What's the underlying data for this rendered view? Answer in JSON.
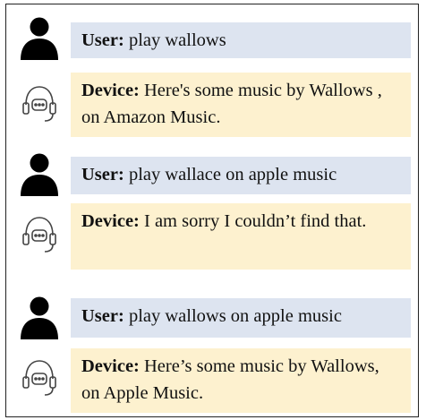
{
  "dialogue": [
    {
      "role": "user",
      "speaker": "User:",
      "text": "play wallows",
      "icon": "user-icon"
    },
    {
      "role": "device",
      "speaker": "Device:",
      "text": "Here's some music by Wallows , on Amazon Music.",
      "icon": "headset-assistant-icon"
    },
    {
      "role": "user",
      "speaker": "User:",
      "text": "play wallace on apple music",
      "icon": "user-icon"
    },
    {
      "role": "device",
      "speaker": "Device:",
      "text": "I am sorry I couldn’t find that.",
      "icon": "headset-assistant-icon"
    },
    {
      "role": "user",
      "speaker": "User:",
      "text": "play wallows on apple music",
      "icon": "user-icon"
    },
    {
      "role": "device",
      "speaker": "Device:",
      "text": "Here’s some music by Wallows, on Apple Music.",
      "icon": "headset-assistant-icon"
    }
  ],
  "colors": {
    "user_bubble": "#dde4f0",
    "device_bubble": "#fdf1cf",
    "icon": "#000000"
  }
}
